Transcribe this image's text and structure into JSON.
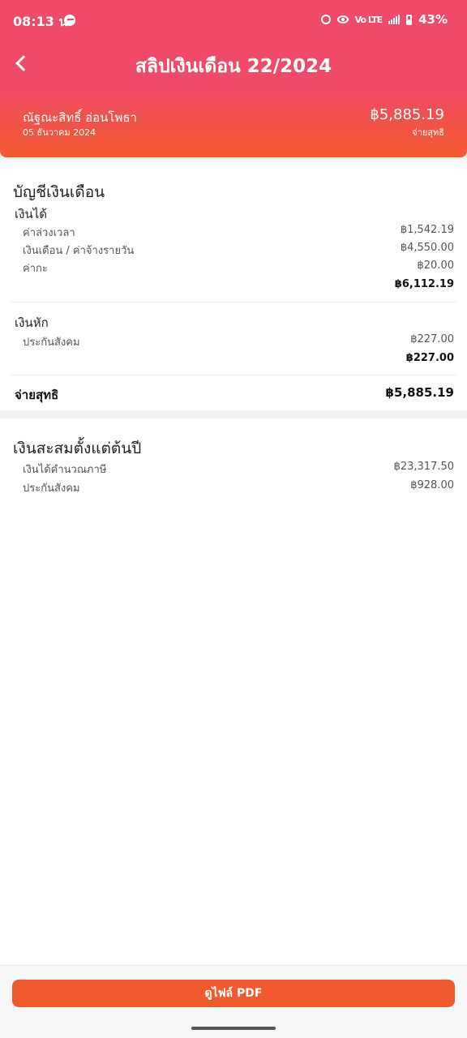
{
  "status_bar": {
    "time": "08:13 น.",
    "battery": "43%",
    "network": "Vo LTE"
  },
  "header": {
    "title": "สลิปเงินเดือน 22/2024",
    "employee_name": "ณัฐณะสิทธิ์ อ่อนโพธา",
    "pay_date": "05 ธันวาคม 2024",
    "net_amount": "฿5,885.19",
    "net_label": "จ่ายสุทธิ"
  },
  "payroll": {
    "section_title": "บัญชีเงินเดือน",
    "earnings": {
      "title": "เงินได้",
      "items": [
        {
          "label": "ค่าล่วงเวลา",
          "value": "฿1,542.19"
        },
        {
          "label": "เงินเดือน / ค่าจ้างรายวัน",
          "value": "฿4,550.00"
        },
        {
          "label": "ค่ากะ",
          "value": "฿20.00"
        }
      ],
      "total": "฿6,112.19"
    },
    "deductions": {
      "title": "เงินหัก",
      "items": [
        {
          "label": "ประกันสังคม",
          "value": "฿227.00"
        }
      ],
      "total": "฿227.00"
    },
    "net": {
      "label": "จ่ายสุทธิ",
      "value": "฿5,885.19"
    }
  },
  "ytd": {
    "section_title": "เงินสะสมตั้งแต่ต้นปี",
    "items": [
      {
        "label": "เงินได้คำนวณภาษี",
        "value": "฿23,317.50"
      },
      {
        "label": "ประกันสังคม",
        "value": "฿928.00"
      }
    ]
  },
  "actions": {
    "view_pdf_label": "ดูไฟล์ PDF"
  },
  "colors": {
    "header_top": "#ef4a68",
    "header_bottom": "#f25a2e",
    "button": "#f05a2f"
  }
}
